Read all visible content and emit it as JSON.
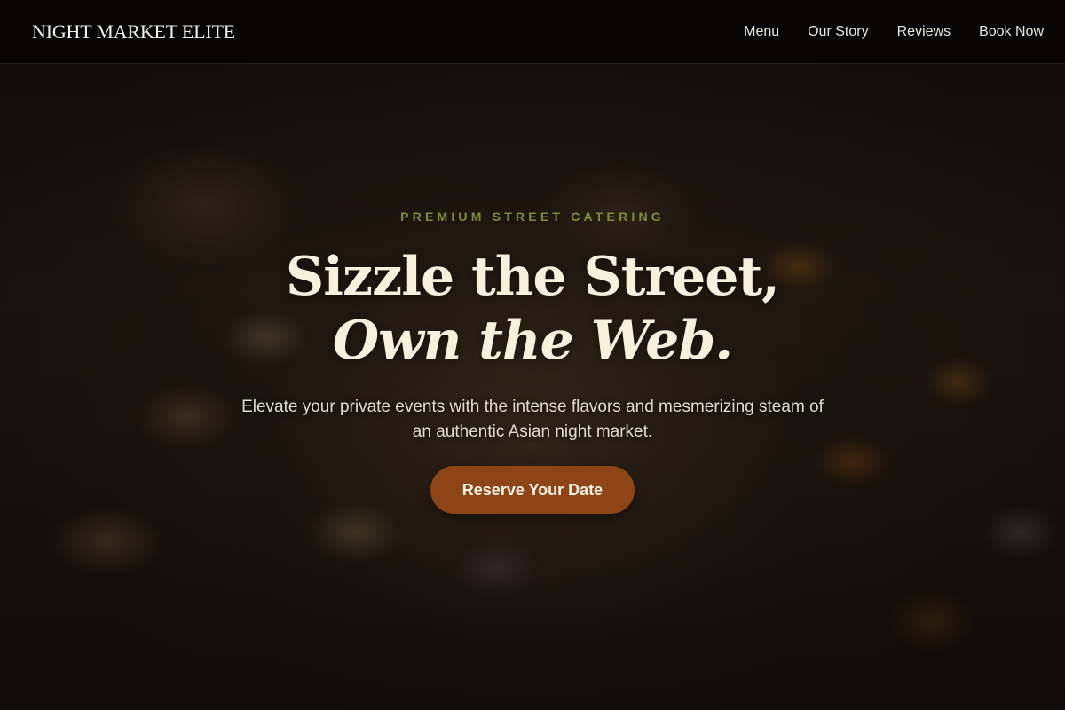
{
  "header": {
    "brand": "NIGHT MARKET ELITE",
    "nav": [
      {
        "label": "Menu"
      },
      {
        "label": "Our Story"
      },
      {
        "label": "Reviews"
      },
      {
        "label": "Book Now"
      }
    ]
  },
  "hero": {
    "eyebrow": "PREMIUM STREET CATERING",
    "headline_line1": "Sizzle the Street,",
    "headline_line2": "Own the Web.",
    "subtitle": "Elevate your private events with the intense flavors and mesmerizing steam of an authentic Asian night market.",
    "cta_label": "Reserve Your Date",
    "background_image": "night-market-catering-photo"
  },
  "colors": {
    "accent_green": "#7c8d3c",
    "cta_brown": "#8d4517",
    "headline_cream": "#f6f0dc",
    "nav_background": "#060504"
  }
}
